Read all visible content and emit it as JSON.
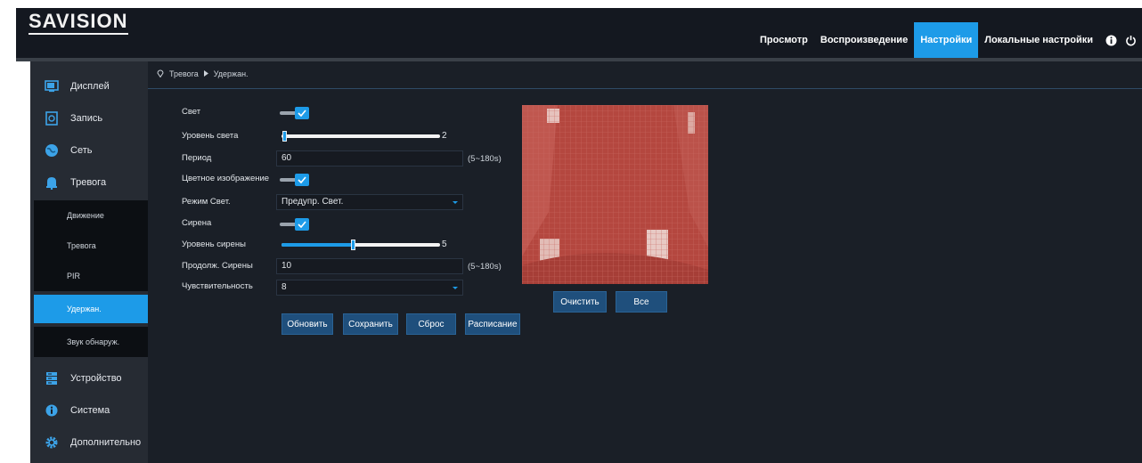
{
  "header": {
    "logo": "SAVISION",
    "nav": [
      {
        "label": "Просмотр",
        "active": false
      },
      {
        "label": "Воспроизведение",
        "active": false
      },
      {
        "label": "Настройки",
        "active": true
      },
      {
        "label": "Локальные настройки",
        "active": false
      }
    ],
    "icons": [
      "info-icon",
      "power-icon"
    ]
  },
  "sidebar": {
    "items": [
      {
        "label": "Дисплей",
        "icon": "display-icon"
      },
      {
        "label": "Запись",
        "icon": "record-icon"
      },
      {
        "label": "Сеть",
        "icon": "network-icon"
      },
      {
        "label": "Тревога",
        "icon": "alarm-icon"
      }
    ],
    "alarm_subitems": [
      {
        "label": "Движение",
        "active": false
      },
      {
        "label": "Тревога",
        "active": false
      },
      {
        "label": "PIR",
        "active": false
      },
      {
        "label": "Удержан.",
        "active": true
      },
      {
        "label": "Звук обнаруж.",
        "active": false
      }
    ],
    "bottom_items": [
      {
        "label": "Устройство",
        "icon": "device-icon"
      },
      {
        "label": "Система",
        "icon": "system-info-icon"
      },
      {
        "label": "Дополнительно",
        "icon": "gear-icon"
      }
    ]
  },
  "breadcrumb": {
    "parent": "Тревога",
    "current": "Удержан."
  },
  "form": {
    "light": {
      "label": "Свет",
      "on": true
    },
    "light_level": {
      "label": "Уровень света",
      "value": "2",
      "fraction": 0.0
    },
    "period": {
      "label": "Период",
      "value": "60",
      "hint": "(5~180s)"
    },
    "color_image": {
      "label": "Цветное изображение",
      "on": true
    },
    "light_mode": {
      "label": "Режим Свет.",
      "value": "Предупр. Свет."
    },
    "siren": {
      "label": "Сирена",
      "on": true
    },
    "siren_level": {
      "label": "Уровень сирены",
      "value": "5",
      "fraction": 0.45
    },
    "siren_duration": {
      "label": "Продолж. Сирены",
      "value": "10",
      "hint": "(5~180s)"
    },
    "sensitivity": {
      "label": "Чувствительность",
      "value": "8"
    }
  },
  "buttons": {
    "refresh": "Обновить",
    "save": "Сохранить",
    "reset": "Сброс",
    "schedule": "Расписание",
    "clear": "Очистить",
    "all": "Все"
  },
  "colors": {
    "accent": "#1d9be8",
    "preview_overlay": "#b64a43",
    "bg": "#1a1f27"
  }
}
